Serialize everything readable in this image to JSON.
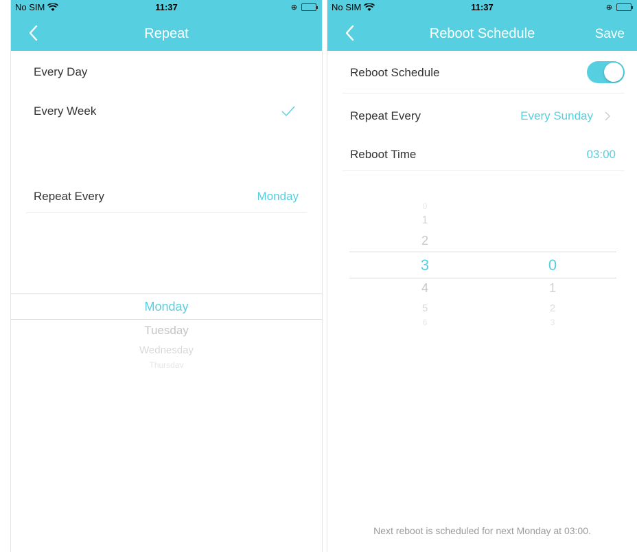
{
  "left": {
    "status": {
      "carrier": "No SIM",
      "time": "11:37"
    },
    "nav": {
      "title": "Repeat"
    },
    "options": [
      {
        "label": "Every Day",
        "selected": false
      },
      {
        "label": "Every Week",
        "selected": true
      }
    ],
    "repeat_every": {
      "label": "Repeat Every",
      "value": "Monday"
    },
    "day_picker": {
      "selected": "Monday",
      "items_below": [
        "Tuesday",
        "Wednesday",
        "Thursday"
      ]
    }
  },
  "right": {
    "status": {
      "carrier": "No SIM",
      "time": "11:37"
    },
    "nav": {
      "title": "Reboot Schedule",
      "action": "Save"
    },
    "reboot_schedule": {
      "label": "Reboot Schedule",
      "enabled": true
    },
    "repeat_every": {
      "label": "Repeat Every",
      "value": "Every Sunday"
    },
    "reboot_time": {
      "label": "Reboot Time",
      "value": "03:00"
    },
    "time_picker": {
      "hour": {
        "above": [
          "0",
          "1",
          "2"
        ],
        "selected": "3",
        "below": [
          "4",
          "5",
          "6"
        ]
      },
      "minute": {
        "selected": "0",
        "below": [
          "1",
          "2",
          "3"
        ]
      }
    },
    "footer_note": "Next reboot is scheduled for next Monday at 03:00."
  },
  "colors": {
    "accent": "#56cfe0",
    "text": "#333333",
    "muted": "#9a9a9a",
    "divider": "#ececec"
  }
}
